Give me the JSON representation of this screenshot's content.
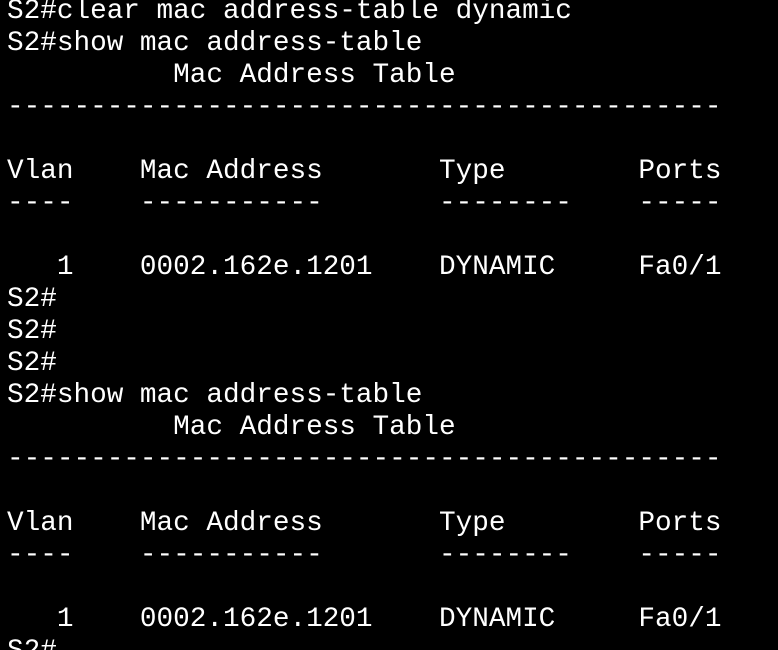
{
  "terminal": {
    "lines": [
      "S2#clear mac address-table dynamic",
      "S2#show mac address-table",
      "          Mac Address Table",
      "-------------------------------------------",
      "",
      "Vlan    Mac Address       Type        Ports",
      "----    -----------       --------    -----",
      "",
      "   1    0002.162e.1201    DYNAMIC     Fa0/1",
      "S2#",
      "S2#",
      "S2#",
      "S2#show mac address-table",
      "          Mac Address Table",
      "-------------------------------------------",
      "",
      "Vlan    Mac Address       Type        Ports",
      "----    -----------       --------    -----",
      "",
      "   1    0002.162e.1201    DYNAMIC     Fa0/1",
      "S2#"
    ]
  }
}
